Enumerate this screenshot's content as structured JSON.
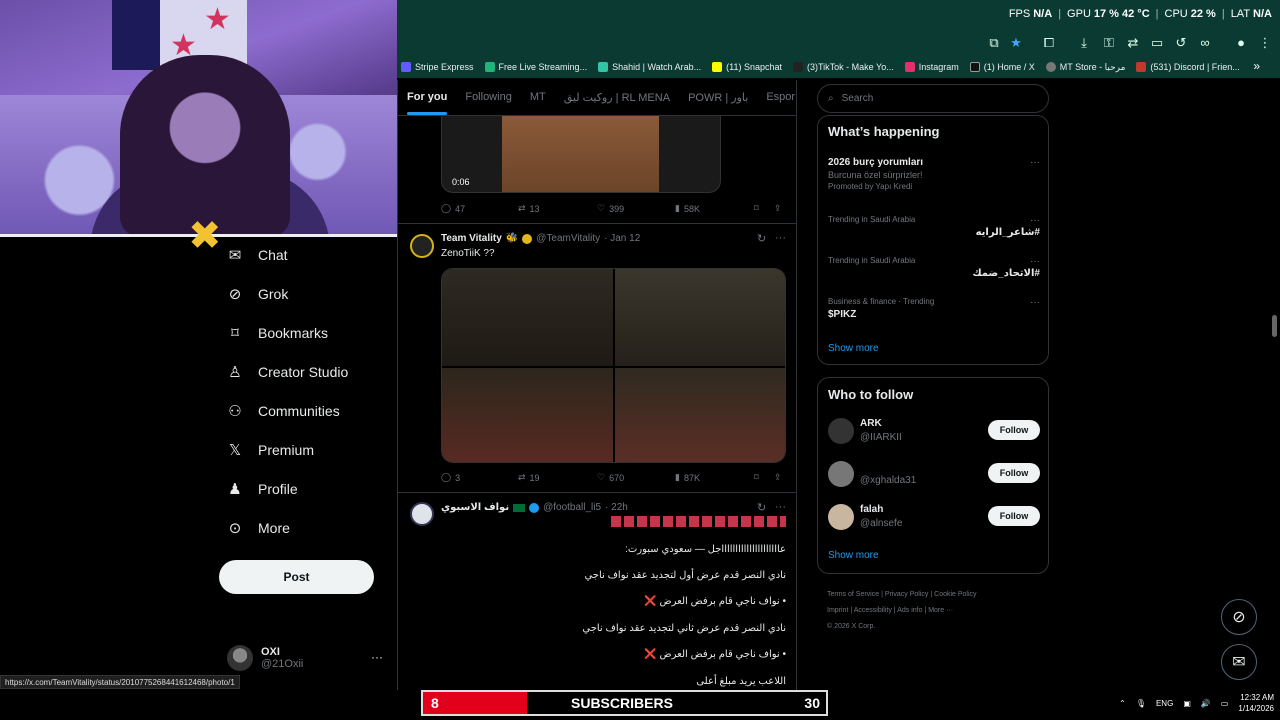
{
  "stream": {
    "stats": [
      {
        "label": "FPS",
        "value": "N/A"
      },
      {
        "label": "GPU",
        "value": "17 % 42 °C"
      },
      {
        "label": "CPU",
        "value": "22 %"
      },
      {
        "label": "LAT",
        "value": "N/A"
      }
    ]
  },
  "bookmarks": [
    {
      "label": "Stripe Express",
      "color": "#635bff"
    },
    {
      "label": "Free Live Streaming...",
      "color": "#1fb47a"
    },
    {
      "label": "Shahid | Watch Arab...",
      "color": "#33c3a5"
    },
    {
      "label": "(11) Snapchat",
      "color": "#fffc00"
    },
    {
      "label": "(3)TikTok - Make Yo...",
      "color": "#222222"
    },
    {
      "label": "Instagram",
      "color": "#e1306c"
    },
    {
      "label": "(1) Home / X",
      "color": "#111111"
    },
    {
      "label": "MT Store - مرحبا",
      "color": "#777777"
    },
    {
      "label": "(531) Discord | Frien...",
      "color": "#c0392b"
    }
  ],
  "nav": [
    {
      "label": "Chat",
      "icon": "chat-icon"
    },
    {
      "label": "Grok",
      "icon": "grok-icon"
    },
    {
      "label": "Bookmarks",
      "icon": "bookmark-icon"
    },
    {
      "label": "Creator Studio",
      "icon": "creator-icon"
    },
    {
      "label": "Communities",
      "icon": "communities-icon"
    },
    {
      "label": "Premium",
      "icon": "x-icon"
    },
    {
      "label": "Profile",
      "icon": "profile-icon"
    },
    {
      "label": "More",
      "icon": "more-icon"
    }
  ],
  "post_label": "Post",
  "profile": {
    "name": "OXI",
    "handle": "@21Oxii"
  },
  "tabs": [
    "For you",
    "Following",
    "MT",
    "روكيت ليق | RL MENA",
    "POWR | باور",
    "Espor"
  ],
  "tweet1": {
    "duration": "0:06",
    "replies": "47",
    "reposts": "13",
    "likes": "399",
    "views": "58K"
  },
  "tweet2": {
    "name": "Team Vitality",
    "handle": "@TeamVitality",
    "time": "· Jan 12",
    "text": "ZenoTiiK ??",
    "replies": "3",
    "reposts": "19",
    "likes": "670",
    "views": "87K"
  },
  "tweet3": {
    "name": "نواف الاسبوي",
    "handle": "@football_li5",
    "time": "· 22h",
    "lines": [
      "عاااااااااااااااااااااجل — سعودي سبورت:",
      "نادي النصر قدم عرض أول لتجديد عقد نواف ناجي",
      "• نواف ناجي قام برفض العرض ❌",
      "نادي النصر قدم عرض ثاني لتجديد عقد نواف ناجي",
      "• نواف ناجي قام برفض العرض ❌",
      "اللاعب يريد مبلغ أعلى"
    ]
  },
  "search_placeholder": "Search",
  "happening": {
    "title": "What’s happening",
    "items": [
      {
        "meta": "",
        "title": "2026 burç yorumları",
        "sub": "Burcuna özel sürprizler!",
        "promo": "Promoted by Yapı Kredi"
      },
      {
        "meta": "Trending in Saudi Arabia",
        "title": "#شاعر_الرايه",
        "sub": "",
        "promo": ""
      },
      {
        "meta": "Trending in Saudi Arabia",
        "title": "#الاتحاد_ضمك",
        "sub": "",
        "promo": ""
      },
      {
        "meta": "Business & finance · Trending",
        "title": "$PIKZ",
        "sub": "",
        "promo": ""
      }
    ],
    "show_more": "Show more"
  },
  "who_to_follow": {
    "title": "Who to follow",
    "accounts": [
      {
        "name": "ARK",
        "handle": "@IIARKII"
      },
      {
        "name": "",
        "handle": "@xghalda31"
      },
      {
        "name": "falah",
        "handle": "@alnsefe"
      }
    ],
    "follow_label": "Follow",
    "show_more": "Show more"
  },
  "footer": {
    "links": [
      "Terms of Service",
      "Privacy Policy",
      "Cookie Policy",
      "Imprint",
      "Accessibility",
      "Ads info",
      "More ···"
    ],
    "copyright": "© 2026 X Corp."
  },
  "status_url": "https://x.com/TeamVitality/status/2010775268441612468/photo/1",
  "subs": {
    "left": "8",
    "label": "SUBSCRIBERS",
    "right": "30"
  },
  "tray": {
    "lang": "ENG",
    "time": "12:32 AM",
    "date": "1/14/2026"
  }
}
